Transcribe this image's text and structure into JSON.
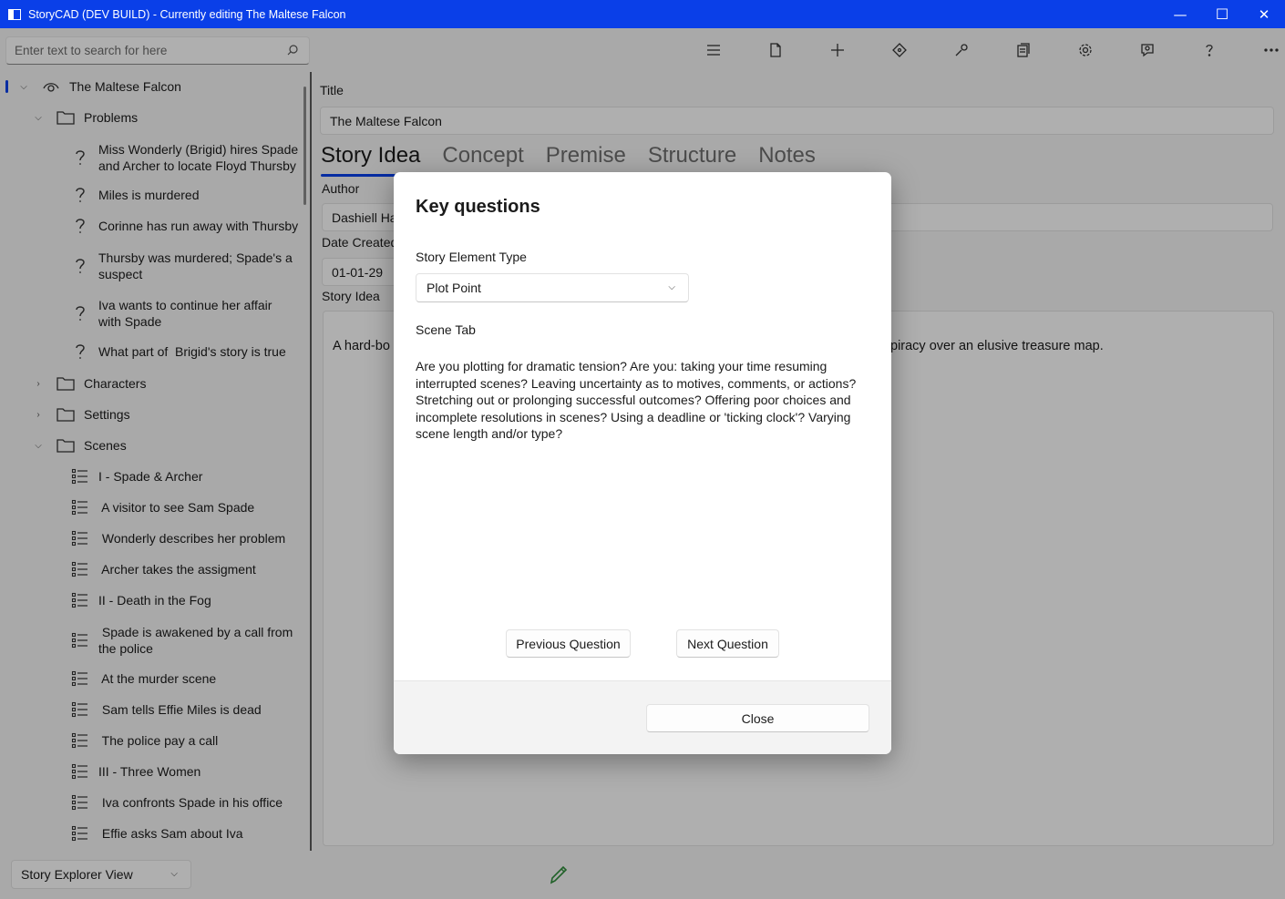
{
  "window": {
    "title": "StoryCAD (DEV BUILD) - Currently editing The Maltese Falcon",
    "minimize": "—",
    "maximize": "☐",
    "close": "✕"
  },
  "search": {
    "placeholder": "Enter text to search for here"
  },
  "toolbar_icons": [
    "menu-icon",
    "file-icon",
    "add-icon",
    "move-icon",
    "tools-icon",
    "report-icon",
    "settings-icon",
    "feedback-icon",
    "help-icon",
    "more-icon"
  ],
  "tree": {
    "root": "The Maltese Falcon",
    "problems": "Problems",
    "problem_items": [
      [
        "Miss Wonderly (Brigid) hires Spade",
        "and Archer to locate Floyd Thursby"
      ],
      [
        "Miles is murdered"
      ],
      [
        "Corinne has run away with Thursby"
      ],
      [
        "Thursby was murdered; Spade's a",
        "suspect"
      ],
      [
        "Iva wants to continue her affair",
        "with Spade"
      ],
      [
        "What part of  Brigid's story is true"
      ]
    ],
    "characters": "Characters",
    "settings": "Settings",
    "scenes": "Scenes",
    "scene_items": [
      [
        "I - Spade & Archer"
      ],
      [
        " A visitor to see Sam Spade"
      ],
      [
        " Wonderly describes her problem"
      ],
      [
        " Archer takes the assigment"
      ],
      [
        "II - Death in the Fog"
      ],
      [
        " Spade is awakened by a call from",
        "the police"
      ],
      [
        " At the murder scene"
      ],
      [
        " Sam tells Effie Miles is dead"
      ],
      [
        " The police pay a call"
      ],
      [
        "III - Three Women"
      ],
      [
        " Iva confronts Spade in his office"
      ],
      [
        " Effie asks Sam about Iva"
      ]
    ]
  },
  "content": {
    "title_label": "Title",
    "title_value": "The Maltese Falcon",
    "tabs": [
      "Story Idea",
      "Concept",
      "Premise",
      "Structure",
      "Notes"
    ],
    "author_label": "Author",
    "author_value": "Dashiell Ha",
    "date_label": "Date Created",
    "date_value": "01-01-29",
    "idea_label": "Story Idea",
    "idea_text_left": "A hard-bo",
    "idea_text_right": "piracy over an elusive treasure map."
  },
  "statusbar": {
    "view": "Story Explorer View"
  },
  "dialog": {
    "title": "Key questions",
    "type_label": "Story Element Type",
    "type_value": "Plot Point",
    "tab_label": "Scene Tab",
    "question": "Are you plotting for dramatic tension? Are you: taking your time resuming interrupted scenes? Leaving uncertainty as to motives, comments, or actions? Stretching out or prolonging successful outcomes? Offering poor choices and incomplete resolutions in scenes? Using a deadline or 'ticking clock'? Varying scene length and/or type?",
    "prev_button": "Previous Question",
    "next_button": "Next Question",
    "close_button": "Close"
  }
}
